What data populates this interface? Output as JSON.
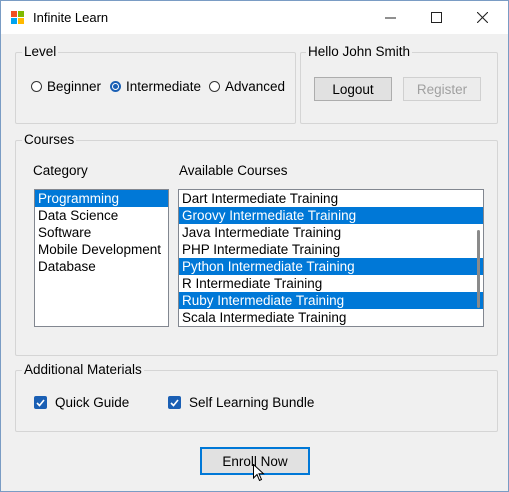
{
  "window": {
    "title": "Infinite Learn",
    "minimize_icon": "minimize-icon",
    "maximize_icon": "maximize-icon",
    "close_icon": "close-icon"
  },
  "level": {
    "label": "Level",
    "options": [
      {
        "label": "Beginner",
        "checked": false
      },
      {
        "label": "Intermediate",
        "checked": true
      },
      {
        "label": "Advanced",
        "checked": false
      }
    ]
  },
  "user": {
    "greeting": "Hello John Smith",
    "logout_label": "Logout",
    "register_label": "Register"
  },
  "courses": {
    "label": "Courses",
    "category_header": "Category",
    "available_header": "Available Courses",
    "categories": [
      {
        "label": "Programming",
        "selected": true
      },
      {
        "label": "Data Science",
        "selected": false
      },
      {
        "label": "Software",
        "selected": false
      },
      {
        "label": "Mobile Development",
        "selected": false
      },
      {
        "label": "Database",
        "selected": false
      }
    ],
    "available": [
      {
        "label": "Dart Intermediate Training",
        "selected": false
      },
      {
        "label": "Groovy Intermediate Training",
        "selected": true
      },
      {
        "label": "Java Intermediate Training",
        "selected": false
      },
      {
        "label": "PHP Intermediate Training",
        "selected": false
      },
      {
        "label": "Python Intermediate Training",
        "selected": true
      },
      {
        "label": "R Intermediate Training",
        "selected": false
      },
      {
        "label": "Ruby Intermediate Training",
        "selected": true
      },
      {
        "label": "Scala Intermediate Training",
        "selected": false
      }
    ]
  },
  "materials": {
    "label": "Additional Materials",
    "quick_guide": {
      "label": "Quick Guide",
      "checked": true
    },
    "bundle": {
      "label": "Self Learning Bundle",
      "checked": true
    }
  },
  "enroll_label": "Enroll Now",
  "colors": {
    "selection": "#0078d7",
    "check": "#1a5fb4"
  }
}
